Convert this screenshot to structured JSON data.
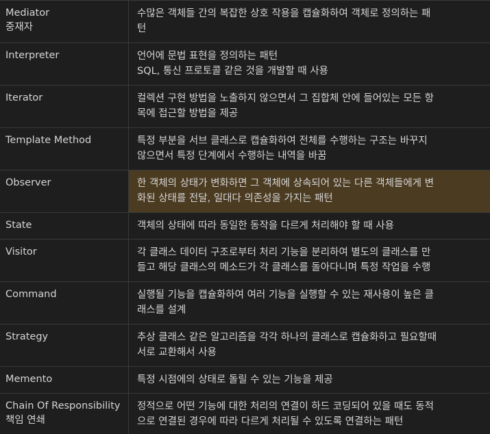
{
  "rows": [
    {
      "name": "Mediator\n중재자",
      "desc": "수많은 객체들 간의 복잡한 상호 작용을 캡슐화하여 객체로 정의하는 패\n턴",
      "highlight": false
    },
    {
      "name": "Interpreter",
      "desc": "언어에 문법 표현을 정의하는 패턴\nSQL, 통신 프로토콜 같은 것을 개발할 때 사용",
      "highlight": false
    },
    {
      "name": "Iterator",
      "desc": "컬렉션 구현 방법을 노출하지 않으면서 그 집합체 안에 들어있는 모든 항\n목에 접근할 방법을 제공",
      "highlight": false
    },
    {
      "name": "Template Method",
      "desc": "특정 부분을 서브 클래스로 캡슐화하여 전체를 수행하는 구조는 바꾸지\n않으면서 특정 단계에서 수행하는 내역을 바꿈",
      "highlight": false
    },
    {
      "name": "Observer",
      "desc": "한 객체의 상태가 변화하면 그 객체에 상속되어 있는 다른 객체들에게 변\n화된 상태를 전달, 일대다 의존성을 가지는 패턴",
      "highlight": true
    },
    {
      "name": "State",
      "desc": "객체의 상태에 따라 동일한 동작을 다르게 처리해야 할 때 사용",
      "highlight": false
    },
    {
      "name": "Visitor",
      "desc": "각 클래스 데이터 구조로부터 처리 기능을 분리하여 별도의 클래스를 만\n들고 해당 클래스의 메소드가 각 클래스를 돌아다니며 특정 작업을 수행",
      "highlight": false
    },
    {
      "name": "Command",
      "desc": "실행될 기능을 캡슐화하여 여러 기능을 실행할 수 있는 재사용이 높은 클\n래스를 설계",
      "highlight": false
    },
    {
      "name": "Strategy",
      "desc": "추상 클래스 같은 알고리즘을 각각 하나의 클래스로 캡슐화하고 필요할때\n서로 교환해서 사용",
      "highlight": false
    },
    {
      "name": "Memento",
      "desc": "특정 시점에의 상태로 돌릴 수 있는 기능을 제공",
      "highlight": false
    },
    {
      "name": "Chain Of Responsibility\n책임 연쇄",
      "desc": "정적으로 어떤 기능에 대한 처리의 연결이 하드 코딩되어 있을 때도 동적\n으로 연결된 경우에 따라 다르게 처리될 수 있도록 연결하는 패턴",
      "highlight": false
    }
  ]
}
